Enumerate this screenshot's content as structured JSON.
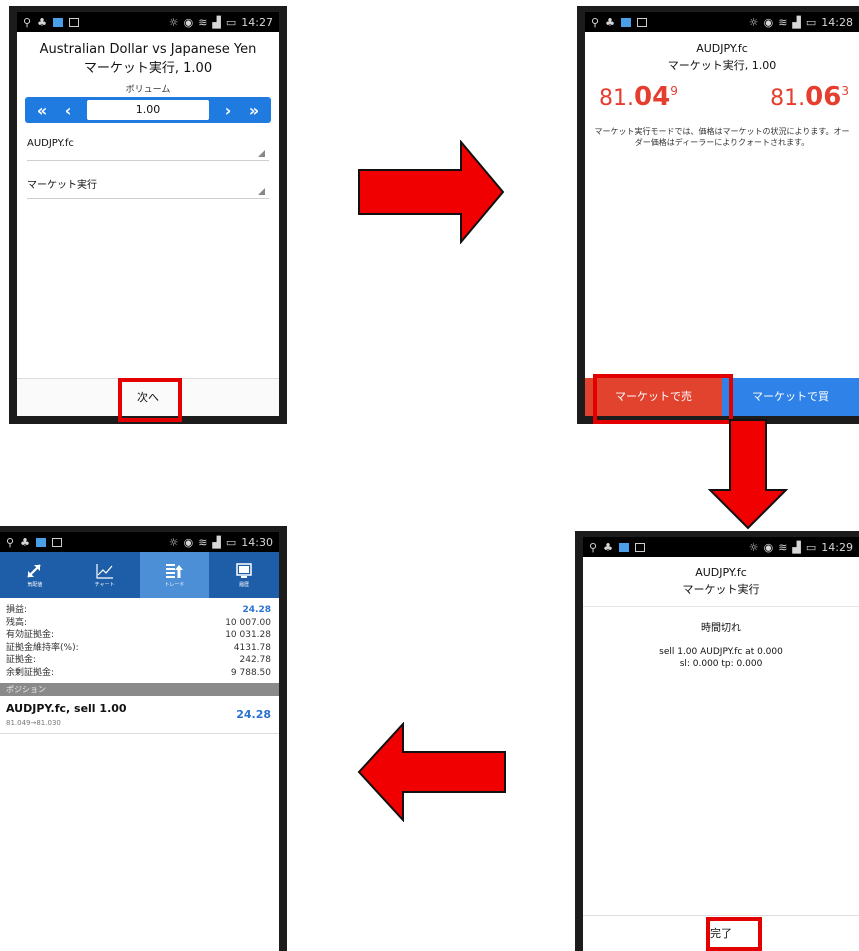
{
  "status_times": {
    "p1": "14:27",
    "p2": "14:28",
    "p3": "14:30",
    "p4": "14:29"
  },
  "screen1": {
    "title_line1": "Australian Dollar vs Japanese Yen",
    "title_line2": "マーケット実行, 1.00",
    "volume_label": "ボリューム",
    "volume_value": "1.00",
    "btn_dec_fast": "«",
    "btn_dec": "‹",
    "btn_inc": "›",
    "btn_inc_fast": "»",
    "symbol": "AUDJPY.fc",
    "order_type": "マーケット実行",
    "next_button": "次へ"
  },
  "screen2": {
    "symbol": "AUDJPY.fc",
    "subtitle": "マーケット実行, 1.00",
    "bid_prefix": "81.",
    "bid_big": "04",
    "bid_sup": "9",
    "ask_prefix": "81.",
    "ask_big": "06",
    "ask_sup": "3",
    "note": "マーケット実行モードでは、価格はマーケットの状況によります。オーダー価格はディーラーによりクォートされます。",
    "sell_button": "マーケットで売",
    "buy_button": "マーケットで買"
  },
  "screen3": {
    "tabs": [
      {
        "label": "気配値",
        "icon": "quotes-icon"
      },
      {
        "label": "チャート",
        "icon": "chart-icon"
      },
      {
        "label": "トレード",
        "icon": "trade-icon"
      },
      {
        "label": "履歴",
        "icon": "history-icon"
      }
    ],
    "summary": [
      {
        "label": "損益:",
        "value": "24.28"
      },
      {
        "label": "残高:",
        "value": "10 007.00"
      },
      {
        "label": "有効証拠金:",
        "value": "10 031.28"
      },
      {
        "label": "証拠金維持率(%):",
        "value": "4131.78"
      },
      {
        "label": "証拠金:",
        "value": "242.78"
      },
      {
        "label": "余剰証拠金:",
        "value": "9 788.50"
      }
    ],
    "positions_header": "ポジション",
    "position_name": "AUDJPY.fc, sell 1.00",
    "position_prices": "81.049→81.030",
    "position_profit": "24.28"
  },
  "screen4": {
    "symbol": "AUDJPY.fc",
    "subtitle": "マーケット実行",
    "message": "時間切れ",
    "detail_line1": "sell 1.00 AUDJPY.fc at 0.000",
    "detail_line2": "sl: 0.000 tp: 0.000",
    "done_button": "完了"
  },
  "colors": {
    "highlight_red": "#e30000",
    "arrow_red": "#f00000",
    "sell_red": "#e2432f",
    "buy_blue": "#2f82e8",
    "volume_blue": "#1f7be0",
    "price_red": "#e53e2e"
  }
}
